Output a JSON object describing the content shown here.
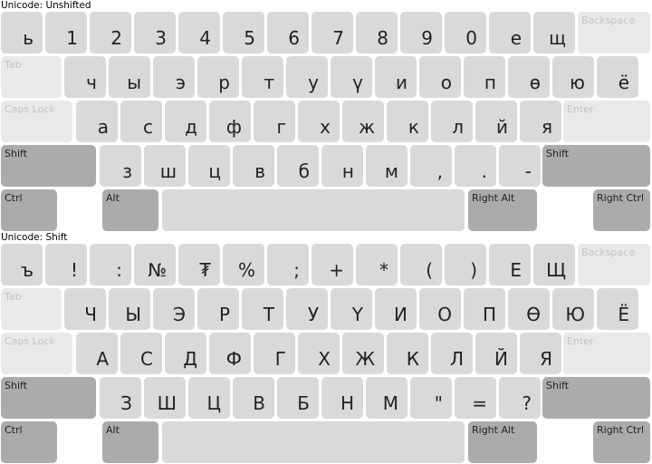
{
  "sections": [
    {
      "label": "Unicode: Unshifted",
      "rows": [
        [
          "ь",
          "1",
          "2",
          "3",
          "4",
          "5",
          "6",
          "7",
          "8",
          "9",
          "0",
          "е",
          "щ"
        ],
        [
          "ч",
          "ы",
          "э",
          "р",
          "т",
          "у",
          "ү",
          "и",
          "о",
          "п",
          "ө",
          "ю",
          "ё"
        ],
        [
          "а",
          "с",
          "д",
          "ф",
          "г",
          "х",
          "ж",
          "к",
          "л",
          "й",
          "я"
        ],
        [
          "з",
          "ш",
          "ц",
          "в",
          "б",
          "н",
          "м",
          ",",
          ".",
          "-"
        ]
      ]
    },
    {
      "label": "Unicode: Shift",
      "rows": [
        [
          "ъ",
          "!",
          ":",
          "№",
          "₮",
          "%",
          ";",
          "+",
          "*",
          "(",
          ")",
          "Е",
          "Щ"
        ],
        [
          "Ч",
          "Ы",
          "Э",
          "Р",
          "Т",
          "У",
          "Ү",
          "И",
          "О",
          "П",
          "Ө",
          "Ю",
          "Ё"
        ],
        [
          "А",
          "С",
          "Д",
          "Ф",
          "Г",
          "Х",
          "Ж",
          "К",
          "Л",
          "Й",
          "Я"
        ],
        [
          "З",
          "Ш",
          "Ц",
          "В",
          "Б",
          "Н",
          "М",
          "\"",
          "=",
          "?"
        ]
      ]
    }
  ],
  "modifiers": {
    "backspace": "Backspace",
    "tab": "Tab",
    "caps_lock": "Caps Lock",
    "enter": "Enter",
    "shift": "Shift",
    "ctrl": "Ctrl",
    "alt": "Alt",
    "right_alt": "Right Alt",
    "right_ctrl": "Right Ctrl"
  },
  "colors": {
    "letter_key": "#d8d9da",
    "unused_key": "#e8e9ea",
    "modifier_key": "#aaabad",
    "background": "#ffffff"
  }
}
